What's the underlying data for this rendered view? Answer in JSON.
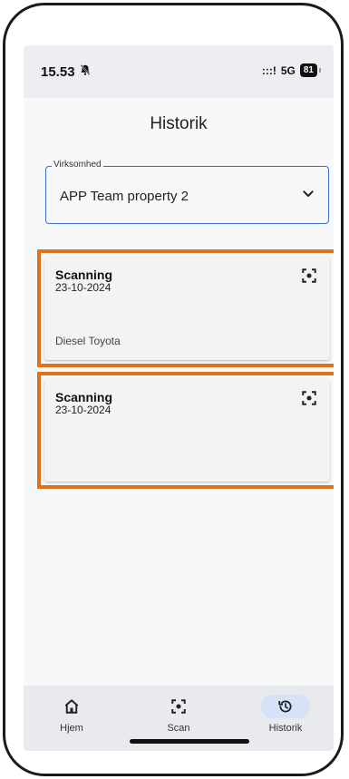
{
  "status_bar": {
    "time": "15.53",
    "signal": ":::!",
    "network": "5G",
    "battery": "81"
  },
  "header": {
    "title": "Historik"
  },
  "company_select": {
    "label": "Virksomhed",
    "value": "APP Team property 2"
  },
  "history": {
    "items": [
      {
        "title": "Scanning",
        "date": "23-10-2024",
        "vehicle": "Diesel Toyota",
        "icon": "scan-icon"
      },
      {
        "title": "Scanning",
        "date": "23-10-2024",
        "vehicle": "",
        "icon": "scan-icon"
      }
    ]
  },
  "bottom_nav": {
    "items": [
      {
        "label": "Hjem",
        "icon": "home-icon",
        "active": false
      },
      {
        "label": "Scan",
        "icon": "scan-icon",
        "active": false
      },
      {
        "label": "Historik",
        "icon": "history-icon",
        "active": true
      }
    ]
  },
  "colors": {
    "highlight_border": "#e0701c",
    "accent": "#3a6ec7",
    "active_nav_bg": "#d6e2f7"
  }
}
